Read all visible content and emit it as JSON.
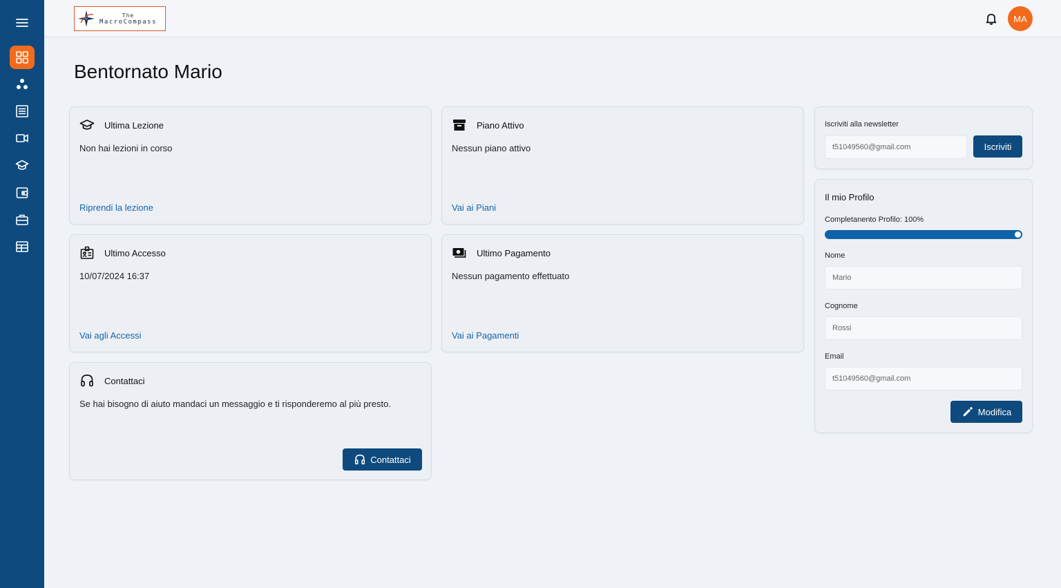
{
  "sidebar": {
    "items": [
      {
        "icon": "menu-icon"
      },
      {
        "icon": "dashboard-icon",
        "active": true
      },
      {
        "icon": "community-icon"
      },
      {
        "icon": "list-icon"
      },
      {
        "icon": "video-icon"
      },
      {
        "icon": "graduation-cap-icon"
      },
      {
        "icon": "wallet-icon"
      },
      {
        "icon": "briefcase-icon"
      },
      {
        "icon": "calendar-table-icon"
      }
    ],
    "colors": {
      "background": "#0e4a7e",
      "active": "#f26a1b"
    }
  },
  "header": {
    "logo": {
      "line1": "The",
      "line2": "MacroCompass"
    },
    "avatar_initials": "MA"
  },
  "page_title": "Bentornato Mario",
  "cards": {
    "ultima_lezione": {
      "title": "Ultima Lezione",
      "body": "Non hai lezioni in corso",
      "link": "Riprendi la lezione"
    },
    "piano_attivo": {
      "title": "Piano Attivo",
      "body": "Nessun piano attivo",
      "link": "Vai ai Piani"
    },
    "ultimo_accesso": {
      "title": "Ultimo Accesso",
      "body": "10/07/2024 16:37",
      "link": "Vai agli Accessi"
    },
    "ultimo_pagamento": {
      "title": "Ultimo Pagamento",
      "body": "Nessun pagamento effettuato",
      "link": "Vai ai Pagamenti"
    },
    "contattaci": {
      "title": "Contattaci",
      "body": "Se hai bisogno di aiuto mandaci un messaggio e ti risponderemo al più presto.",
      "button": "Contattaci"
    }
  },
  "newsletter": {
    "label": "Iscriviti alla newsletter",
    "email_value": "t51049560@gmail.com",
    "button": "Iscriviti"
  },
  "profile": {
    "title": "Il mio Profilo",
    "completion_label": "Completanento Profilo: 100%",
    "completion_fraction": 1.0,
    "fields": {
      "nome": {
        "label": "Nome",
        "value": "Mario"
      },
      "cognome": {
        "label": "Cognome",
        "value": "Rossi"
      },
      "email": {
        "label": "Email",
        "value": "t51049560@gmail.com"
      }
    },
    "button": "Modifica"
  },
  "colors": {
    "accent": "#0e4a7e",
    "orange": "#f26a1b",
    "link": "#1565a6"
  }
}
